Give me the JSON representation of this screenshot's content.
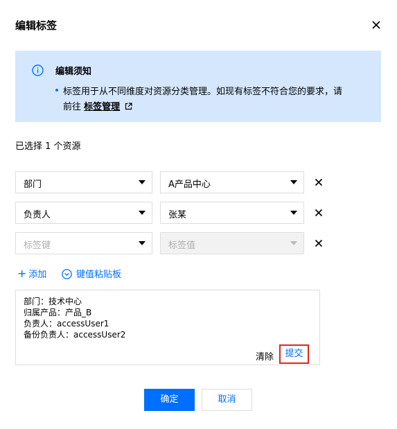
{
  "dialog": {
    "title": "编辑标签"
  },
  "notice": {
    "title": "编辑须知",
    "line1": "标签用于从不同维度对资源分类管理。如现有标签不符合您的要求，请",
    "line2_prefix": "前往 ",
    "link_label": "标签管理"
  },
  "selected_count": "已选择 1 个资源",
  "tag_rows": [
    {
      "key": "部门",
      "value": "A产品中心"
    },
    {
      "key": "负责人",
      "value": "张某"
    },
    {
      "key_placeholder": "标签键",
      "value_placeholder": "标签值"
    }
  ],
  "actions": {
    "add_label": "添加",
    "clipboard_label": "键值粘贴板"
  },
  "clipboard": {
    "content": "部门：技术中心\n归属产品：产品_B\n负责人：accessUser1\n备份负责人：accessUser2",
    "clear_label": "清除",
    "submit_label": "提交"
  },
  "footer": {
    "confirm_label": "确定",
    "cancel_label": "取消"
  },
  "colors": {
    "accent": "#006eff",
    "notice_bg": "#d5e7fd",
    "highlight_border": "#e1251b"
  },
  "icons": {
    "close": "close-icon",
    "info": "info-icon",
    "external_link": "external-link-icon",
    "row_remove": "close-icon",
    "clipboard": "chevron-down-circle-icon"
  }
}
